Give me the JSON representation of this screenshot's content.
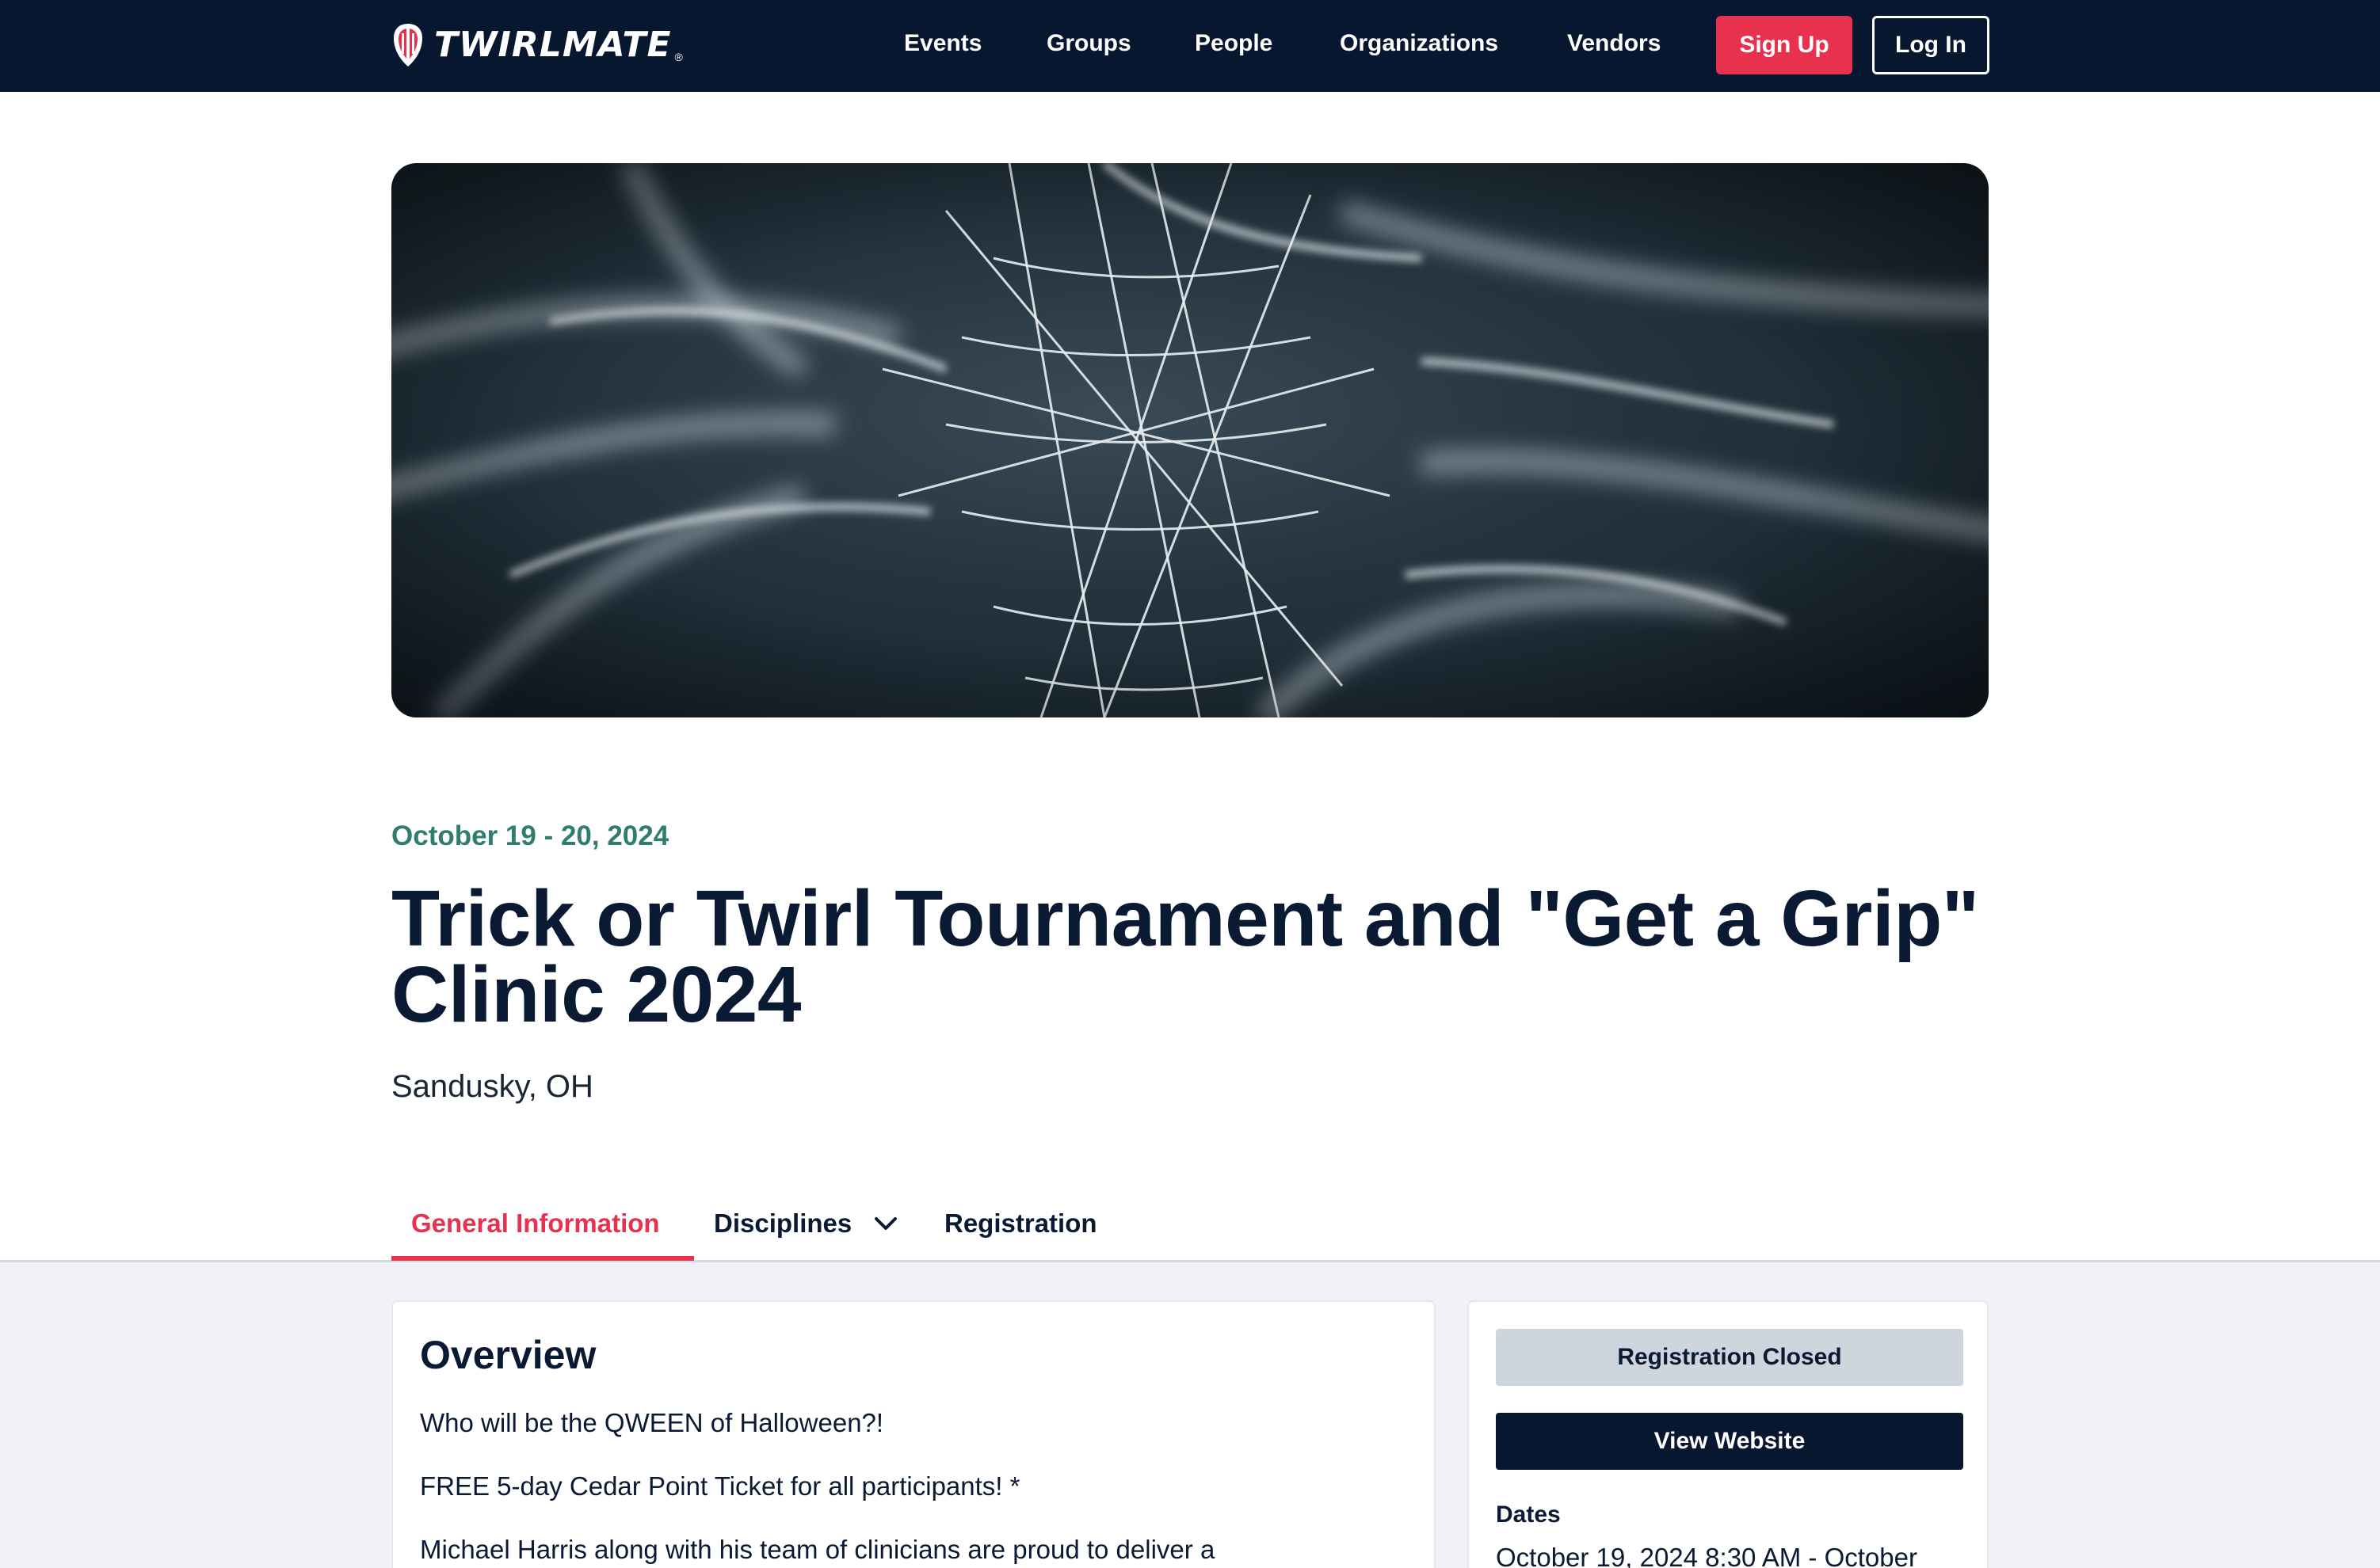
{
  "brand": {
    "name": "TWIRLMATE",
    "reg_mark": "®"
  },
  "nav": {
    "links": [
      "Events",
      "Groups",
      "People",
      "Organizations",
      "Vendors"
    ],
    "signup": "Sign Up",
    "login": "Log In"
  },
  "event": {
    "date": "October 19 - 20, 2024",
    "title": "Trick or Twirl Tournament and \"Get a Grip\" Clinic 2024",
    "location": "Sandusky, OH"
  },
  "tabs": {
    "general": "General Information",
    "disciplines": "Disciplines",
    "registration": "Registration"
  },
  "overview": {
    "title": "Overview",
    "paragraphs": [
      "Who will be the QWEEN of Halloween?!",
      "FREE 5-day Cedar Point Ticket for all participants! *",
      "Michael Harris along with his team of clinicians are proud to deliver a"
    ]
  },
  "sidebar": {
    "registration_status": "Registration Closed",
    "view_website": "View Website",
    "dates_label": "Dates",
    "dates_value": "October 19, 2024 8:30 AM - October"
  },
  "colors": {
    "nav_bg": "#081730",
    "accent_red": "#e8304f",
    "date_green": "#2f7d6d",
    "page_bg_lower": "#f0f2f6"
  }
}
